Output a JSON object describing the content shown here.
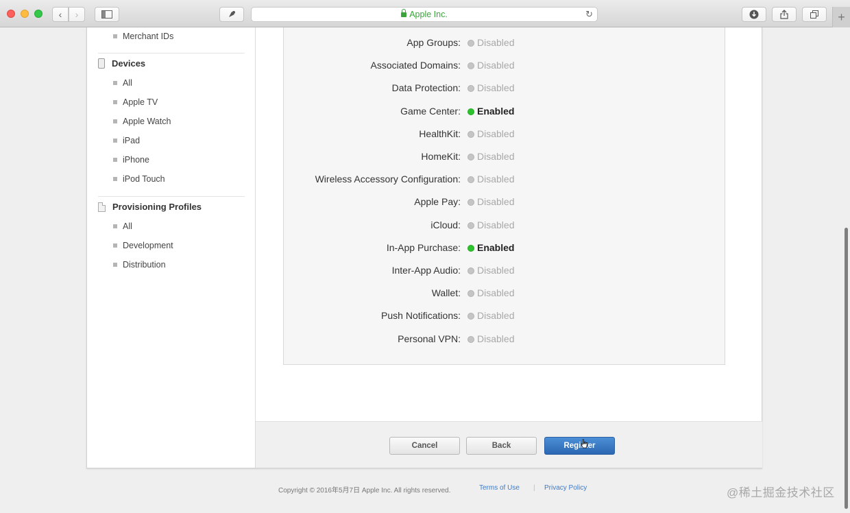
{
  "browser": {
    "address": "Apple Inc."
  },
  "sidebar": {
    "top_item": "Merchant IDs",
    "devices_header": "Devices",
    "devices": [
      "All",
      "Apple TV",
      "Apple Watch",
      "iPad",
      "iPhone",
      "iPod Touch"
    ],
    "profiles_header": "Provisioning Profiles",
    "profiles": [
      "All",
      "Development",
      "Distribution"
    ]
  },
  "services": [
    {
      "label": "App Groups:",
      "status": "Disabled",
      "enabled": false
    },
    {
      "label": "Associated Domains:",
      "status": "Disabled",
      "enabled": false
    },
    {
      "label": "Data Protection:",
      "status": "Disabled",
      "enabled": false
    },
    {
      "label": "Game Center:",
      "status": "Enabled",
      "enabled": true
    },
    {
      "label": "HealthKit:",
      "status": "Disabled",
      "enabled": false
    },
    {
      "label": "HomeKit:",
      "status": "Disabled",
      "enabled": false
    },
    {
      "label": "Wireless Accessory Configuration:",
      "status": "Disabled",
      "enabled": false
    },
    {
      "label": "Apple Pay:",
      "status": "Disabled",
      "enabled": false
    },
    {
      "label": "iCloud:",
      "status": "Disabled",
      "enabled": false
    },
    {
      "label": "In-App Purchase:",
      "status": "Enabled",
      "enabled": true
    },
    {
      "label": "Inter-App Audio:",
      "status": "Disabled",
      "enabled": false
    },
    {
      "label": "Wallet:",
      "status": "Disabled",
      "enabled": false
    },
    {
      "label": "Push Notifications:",
      "status": "Disabled",
      "enabled": false
    },
    {
      "label": "Personal VPN:",
      "status": "Disabled",
      "enabled": false
    }
  ],
  "actions": {
    "cancel": "Cancel",
    "back": "Back",
    "register": "Register"
  },
  "footer": {
    "copyright": "Copyright © 2016年5月7日 Apple Inc. All rights reserved.",
    "terms": "Terms of Use",
    "divider": "|",
    "privacy": "Privacy Policy"
  },
  "watermark": "@稀土掘金技术社区",
  "colors": {
    "enabled_dot": "#2cc32c",
    "disabled_dot": "#c5c5c5",
    "primary_button": "#2c67b2",
    "link": "#3d7bc9",
    "secure_address": "#3aa43a"
  }
}
